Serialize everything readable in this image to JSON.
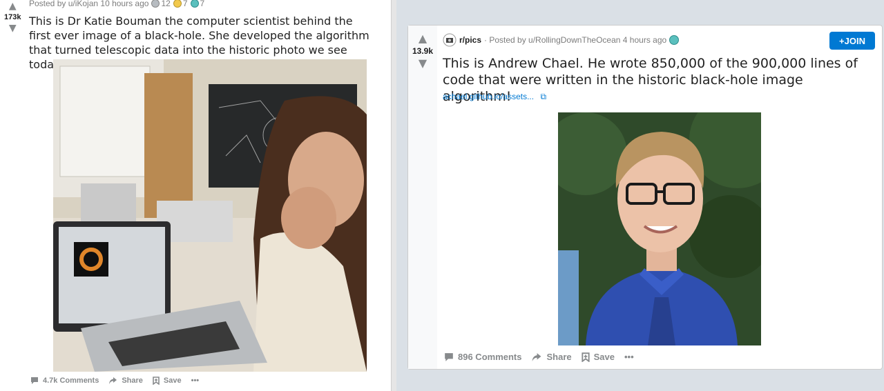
{
  "left_post": {
    "meta_text": "Posted by u/iKojan 10 hours ago",
    "awards": [
      {
        "icon": "silver-award-icon",
        "count": "12",
        "color": "#b7bcc1"
      },
      {
        "icon": "gold-award-icon",
        "count": "7",
        "color": "#f2c94c"
      },
      {
        "icon": "platinum-award-icon",
        "count": "7",
        "color": "#5bc0be"
      }
    ],
    "score": "173k",
    "title": "This is Dr Katie Bouman the computer scientist behind the first ever image of a black-hole. She developed the algorithm that turned telescopic data into the historic photo we see today.",
    "actions": {
      "comments": "4.7k Comments",
      "share": "Share",
      "save": "Save",
      "more": "•••"
    }
  },
  "right_post": {
    "subreddit": "r/pics",
    "meta_text": "· Posted by u/RollingDownTheOcean 4 hours ago",
    "join_label": "+JOIN",
    "score": "13.9k",
    "title": "This is Andrew Chael. He wrote 850,000 of the 900,000 lines of code that were written in the historic black-hole image algorithm!",
    "link_text": "achael.github.io/assets...",
    "link_icon": "external-link-icon",
    "actions": {
      "comments": "896 Comments",
      "share": "Share",
      "save": "Save",
      "more": "•••"
    }
  },
  "colors": {
    "accent": "#0079d3",
    "page_bg": "#dae0e6",
    "meta": "#7c7c7c"
  }
}
